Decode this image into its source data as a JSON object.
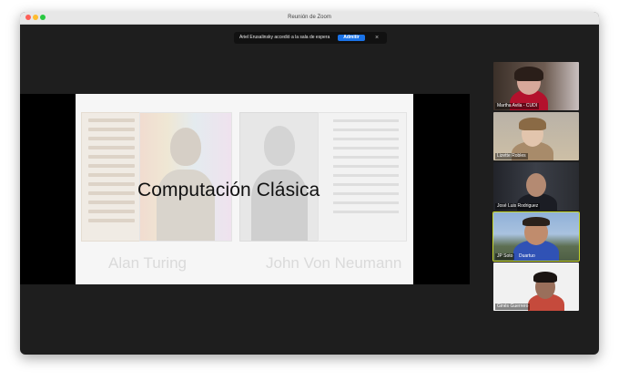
{
  "window": {
    "title": "Reunión de Zoom"
  },
  "waiting_room": {
    "message": "Ariel Erusalinsky accedió a la sala de espera",
    "admit_label": "Admitir",
    "close_icon": "×"
  },
  "slide": {
    "title": "Computación Clásica",
    "captions": [
      "Alan Turing",
      "John Von Neumann"
    ]
  },
  "participants": [
    {
      "name": "Martha Avila - CUDI",
      "sub": ""
    },
    {
      "name": "Lizette Robles",
      "sub": ""
    },
    {
      "name": "José Luis Rodriguez",
      "sub": ""
    },
    {
      "name": "JP Soto",
      "sub": "Duartuo"
    },
    {
      "name": "Ginés Guerrero",
      "sub": ""
    }
  ],
  "colors": {
    "admit_button": "#1a73e8",
    "active_speaker_border": "#c8d82c",
    "window_background": "#1e1e1e"
  }
}
